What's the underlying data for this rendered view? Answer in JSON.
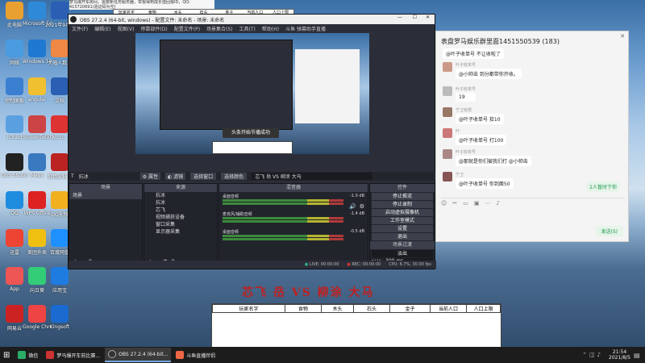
{
  "top_strip": {
    "note_text": "梦马爆开车房间，需要新任务服务器，举报得到成长值回报ID，QQ: 415720691(验证码为空)",
    "cols": [
      "玩家名字",
      "食物",
      "木头",
      "石头",
      "金子",
      "当前人口",
      "人口上限"
    ]
  },
  "desktop_icons": [
    {
      "label": "此电脑"
    },
    {
      "label": "Microsoft Edge"
    },
    {
      "label": "2021年9月..."
    },
    {
      "label": "网络"
    },
    {
      "label": "Windows 10 Edge"
    },
    {
      "label": "大幅人数..."
    },
    {
      "label": "控制面板"
    },
    {
      "label": "angular"
    },
    {
      "label": "文档"
    },
    {
      "label": "iCloud"
    },
    {
      "label": "ScreenToGif"
    },
    {
      "label": "AE.G..."
    },
    {
      "label": "OBS Studio"
    },
    {
      "label": "Maya"
    },
    {
      "label": "红色文档..."
    },
    {
      "label": "QQ"
    },
    {
      "label": "WPS Office"
    },
    {
      "label": "QQ视频"
    },
    {
      "label": "迅雷"
    },
    {
      "label": "美团外卖"
    },
    {
      "label": "百度网盘"
    },
    {
      "label": "App"
    },
    {
      "label": "向日葵"
    },
    {
      "label": "应用宝"
    },
    {
      "label": "网易云"
    },
    {
      "label": "Google Chrome"
    },
    {
      "label": "Kingsoft"
    }
  ],
  "obs": {
    "title": "OBS 27.2.4 (64-bit, windows) - 配置文件: 未命名 - 场景: 未命名",
    "menu": [
      "文件(F)",
      "编辑(E)",
      "视图(V)",
      "停靠部件(D)",
      "配置文件(P)",
      "场景集合(S)",
      "工具(T)",
      "帮助(H)",
      "斗鱼 弹幕助手直播"
    ],
    "sub_toolbar": {
      "source_label": "抗冰",
      "props": "属性",
      "filters": "滤镜",
      "select_window": "选择窗口",
      "select_color": "选择颜色",
      "scene_text": "芯飞  岳  VS  柳涂  大马"
    },
    "preview_popup": "头条开始节播成功",
    "docks": {
      "scenes": {
        "title": "场景",
        "items": [
          "场景"
        ]
      },
      "sources": {
        "title": "来源",
        "items": [
          "抗冰",
          "抗冰",
          "芯飞",
          "视频捕获设备",
          "窗口采集",
          "显示器采集"
        ]
      },
      "mixer": {
        "title": "混音器",
        "tracks": [
          {
            "name": "桌面音频",
            "db": "-1.0 dB"
          },
          {
            "name": "麦克风/辅助音频",
            "db": "-1.4 dB"
          },
          {
            "name": "桌面音频",
            "db": "-0.5 dB"
          }
        ]
      },
      "transitions": {
        "title": "场景过渡",
        "type": "淡出",
        "duration_label": "时长",
        "duration": "300 ms"
      },
      "controls": {
        "title": "控件",
        "buttons": [
          "停止推流",
          "停止录制",
          "启动虚拟摄像机",
          "工作室模式",
          "设置",
          "退出"
        ]
      }
    },
    "status": {
      "live": "LIVE: 00:00:00",
      "rec": "REC: 00:00:00",
      "cpu": "CPU: 6.7%, 30.00 fps"
    }
  },
  "chat": {
    "title": "表盘罗马娱乐群里面1451550539 (183)",
    "messages": [
      {
        "name": "叶子收单号",
        "text": "@叶子收单号 不让收啦了"
      },
      {
        "name": "叶子收单号",
        "text": "@小帅击 到分都带你开收。"
      },
      {
        "name": "叶子收单号",
        "text": "19"
      },
      {
        "name": "宁卫有限",
        "text": "@叶子收单号 拾10"
      },
      {
        "name": "叶",
        "text": "@叶子收单号 打100"
      },
      {
        "name": "叶子收单号",
        "text": "@那就是你们被我们打 @小帅击"
      },
      {
        "name": "宁卫",
        "text": "@叶子收单号 你到面50"
      }
    ],
    "new_msgs_badge": "2人暂时下你",
    "send_button": "发送(S)"
  },
  "overlay_title": "芯飞  岳  VS  柳涂  大马",
  "score_table": {
    "headers": [
      "玩家名字",
      "食物",
      "木头",
      "石头",
      "金子",
      "当前人口",
      "人口上限"
    ]
  },
  "taskbar": {
    "items": [
      {
        "label": "微信",
        "color": "#2aae67"
      },
      {
        "label": "梦马爆开车前比赛...",
        "color": "#c33"
      },
      {
        "label": "OBS 27.2.4 (64-bit...",
        "color": "#333",
        "active": true
      },
      {
        "label": "斗鱼直播伴侣",
        "color": "#e64"
      }
    ],
    "time": "21:54",
    "date": "2021/8/5"
  }
}
